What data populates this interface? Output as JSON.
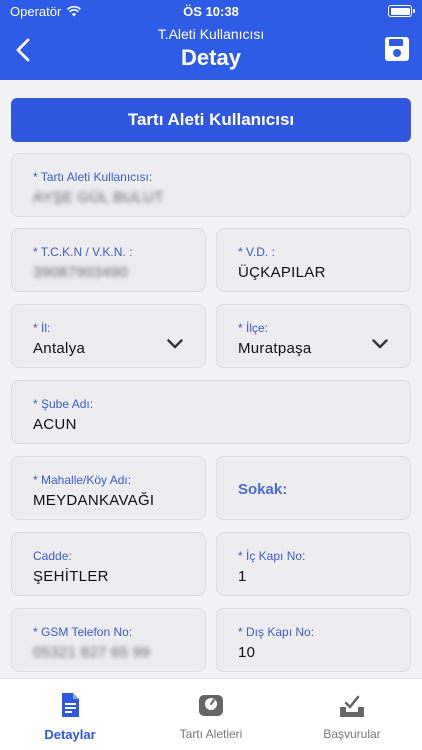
{
  "status": {
    "carrier": "Operatör",
    "time": "ÖS 10:38"
  },
  "header": {
    "subtitle": "T.Aleti Kullanıcısı",
    "title": "Detay"
  },
  "section_button": "Tartı Aleti Kullanıcısı",
  "fields": {
    "user": {
      "label": "* Tartı Aleti Kullanıcısı:",
      "value": "AYŞE GÜL BULUT"
    },
    "tckn": {
      "label": "* T.C.K.N / V.K.N. :",
      "value": "39087903490"
    },
    "vd": {
      "label": "* V.D. :",
      "value": "ÜÇKAPILAR"
    },
    "il": {
      "label": "* İl:",
      "value": "Antalya"
    },
    "ilce": {
      "label": "* İlçe:",
      "value": "Muratpaşa"
    },
    "sube": {
      "label": "* Şube Adı:",
      "value": "ACUN"
    },
    "mahalle": {
      "label": "* Mahalle/Köy Adı:",
      "value": "MEYDANKAVAĞI"
    },
    "sokak": {
      "label": "Sokak:"
    },
    "cadde": {
      "label": "Cadde:",
      "value": "ŞEHİTLER"
    },
    "ickapi": {
      "label": "* İç Kapı No:",
      "value": "1"
    },
    "gsm": {
      "label": "* GSM Telefon No:",
      "value": "05321 827 65 99"
    },
    "diskapi": {
      "label": "* Dış Kapı No:",
      "value": "10"
    }
  },
  "tabs": [
    {
      "label": "Detaylar",
      "icon": "document-icon",
      "active": true
    },
    {
      "label": "Tartı Aletleri",
      "icon": "scale-icon",
      "active": false
    },
    {
      "label": "Başvurular",
      "icon": "inbox-check-icon",
      "active": false
    }
  ],
  "colors": {
    "primary": "#2f5ce6",
    "label": "#3a5cc9",
    "field_bg": "#ededef"
  }
}
